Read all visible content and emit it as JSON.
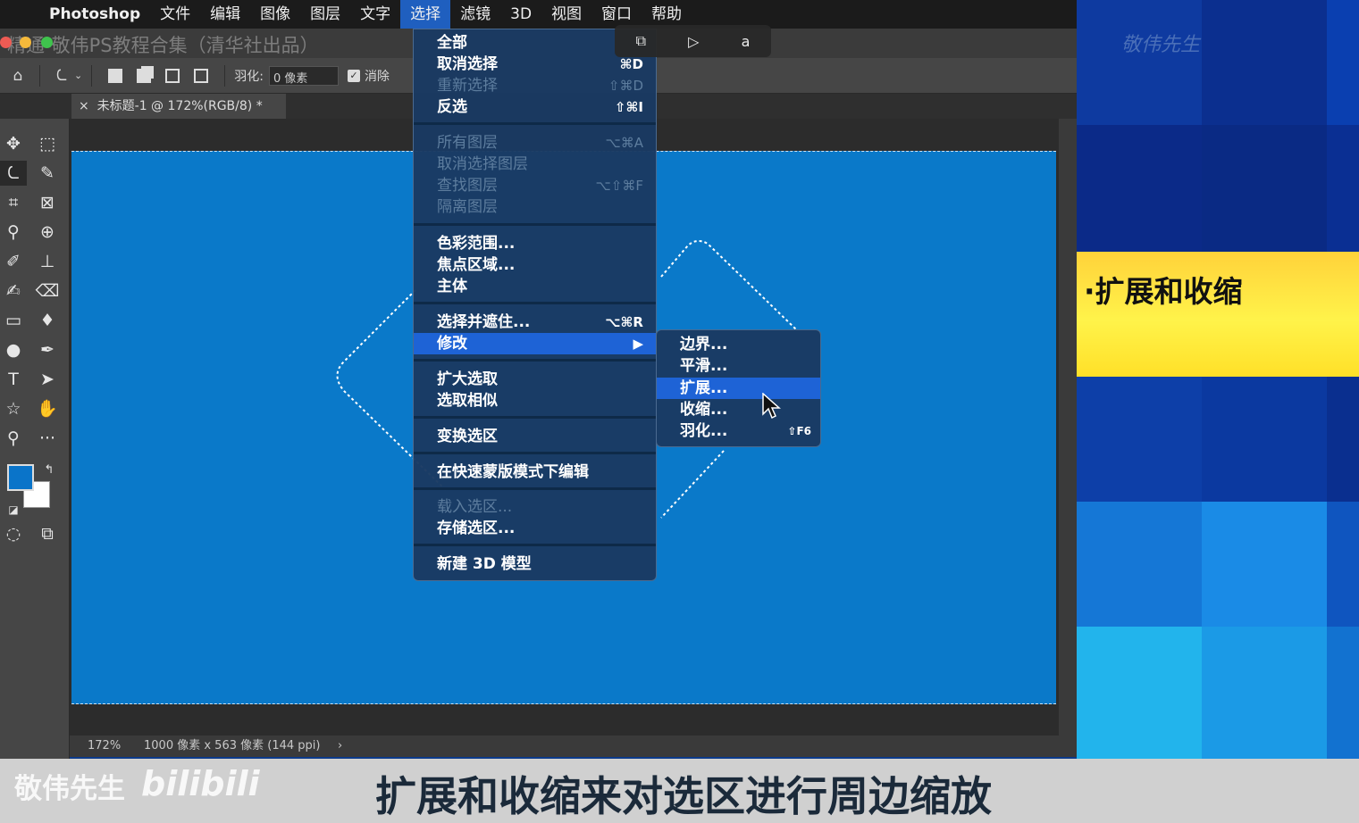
{
  "menubar": {
    "app": "Photoshop",
    "items": [
      "文件",
      "编辑",
      "图像",
      "图层",
      "文字",
      "选择",
      "滤镜",
      "3D",
      "视图",
      "窗口",
      "帮助"
    ],
    "active": "选择"
  },
  "window": {
    "title": "精通-敬伟PS教程合集（清华社出品）"
  },
  "options": {
    "feather_label": "羽化:",
    "feather_value": "0 像素",
    "antialias_label": "消除"
  },
  "tab": {
    "close": "×",
    "label": "未标题-1 @ 172%(RGB/8) *"
  },
  "select_menu": {
    "items": [
      {
        "label": "全部",
        "shortcut": "",
        "disabled": false
      },
      {
        "label": "取消选择",
        "shortcut": "⌘D",
        "disabled": false
      },
      {
        "label": "重新选择",
        "shortcut": "⇧⌘D",
        "disabled": true
      },
      {
        "label": "反选",
        "shortcut": "⇧⌘I",
        "disabled": false
      },
      {
        "label": "所有图层",
        "shortcut": "⌥⌘A",
        "disabled": true
      },
      {
        "label": "取消选择图层",
        "shortcut": "",
        "disabled": true
      },
      {
        "label": "查找图层",
        "shortcut": "⌥⇧⌘F",
        "disabled": true
      },
      {
        "label": "隔离图层",
        "shortcut": "",
        "disabled": true
      },
      {
        "label": "色彩范围...",
        "shortcut": "",
        "disabled": false
      },
      {
        "label": "焦点区域...",
        "shortcut": "",
        "disabled": false
      },
      {
        "label": "主体",
        "shortcut": "",
        "disabled": false
      },
      {
        "label": "选择并遮住...",
        "shortcut": "⌥⌘R",
        "disabled": false
      },
      {
        "label": "修改",
        "shortcut": "▶",
        "disabled": false
      },
      {
        "label": "扩大选取",
        "shortcut": "",
        "disabled": false
      },
      {
        "label": "选取相似",
        "shortcut": "",
        "disabled": false
      },
      {
        "label": "变换选区",
        "shortcut": "",
        "disabled": false
      },
      {
        "label": "在快速蒙版模式下编辑",
        "shortcut": "",
        "disabled": false
      },
      {
        "label": "载入选区...",
        "shortcut": "",
        "disabled": true
      },
      {
        "label": "存储选区...",
        "shortcut": "",
        "disabled": false
      },
      {
        "label": "新建 3D 模型",
        "shortcut": "",
        "disabled": false
      }
    ]
  },
  "modify_submenu": {
    "items": [
      {
        "label": "边界...",
        "shortcut": ""
      },
      {
        "label": "平滑...",
        "shortcut": ""
      },
      {
        "label": "扩展...",
        "shortcut": ""
      },
      {
        "label": "收缩...",
        "shortcut": ""
      },
      {
        "label": "羽化...",
        "shortcut": "⇧F6"
      }
    ],
    "highlighted": "扩展..."
  },
  "status": {
    "zoom": "172%",
    "doc_info": "1000 像素 x 563 像素 (144 ppi)",
    "arrow": "›"
  },
  "right_panel": {
    "watermark": "敬伟先生",
    "label": "·扩展和收缩"
  },
  "subtitle": {
    "brand": "敬伟先生",
    "logo": "bilibili",
    "caption": "扩展和收缩来对选区进行周边缩放"
  },
  "colors": {
    "canvas": "#0a79c9",
    "menu_bg": "#1a3a62",
    "highlight": "#1e63d6",
    "foreground": "#0a74c9",
    "background": "#ffffff"
  }
}
